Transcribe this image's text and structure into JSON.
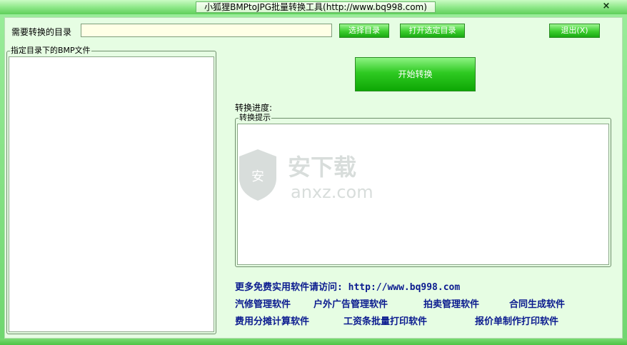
{
  "window": {
    "title": "小狐狸BMPtoJPG批量转换工具(http://www.bq998.com)",
    "close_glyph": "×"
  },
  "toolbar": {
    "dir_label": "需要转换的目录",
    "dir_value": "",
    "select_dir_label": "选择目录",
    "open_dir_label": "打开选定目录",
    "exit_label": "退出(X)"
  },
  "bmp_group": {
    "legend": "指定目录下的BMP文件"
  },
  "start_button": {
    "label": "开始转换"
  },
  "progress": {
    "label": "转换进度:"
  },
  "tips_group": {
    "legend": "转换提示"
  },
  "watermark": {
    "text": "安下载",
    "domain": "anxz.com"
  },
  "links": {
    "visit": "更多免费实用软件请访问: http://www.bq998.com",
    "row1": [
      "汽修管理软件",
      "户外广告管理软件",
      "拍卖管理软件",
      "合同生成软件"
    ],
    "row2": [
      "费用分摊计算软件",
      "工资条批量打印软件",
      "报价单制作打印软件"
    ]
  }
}
